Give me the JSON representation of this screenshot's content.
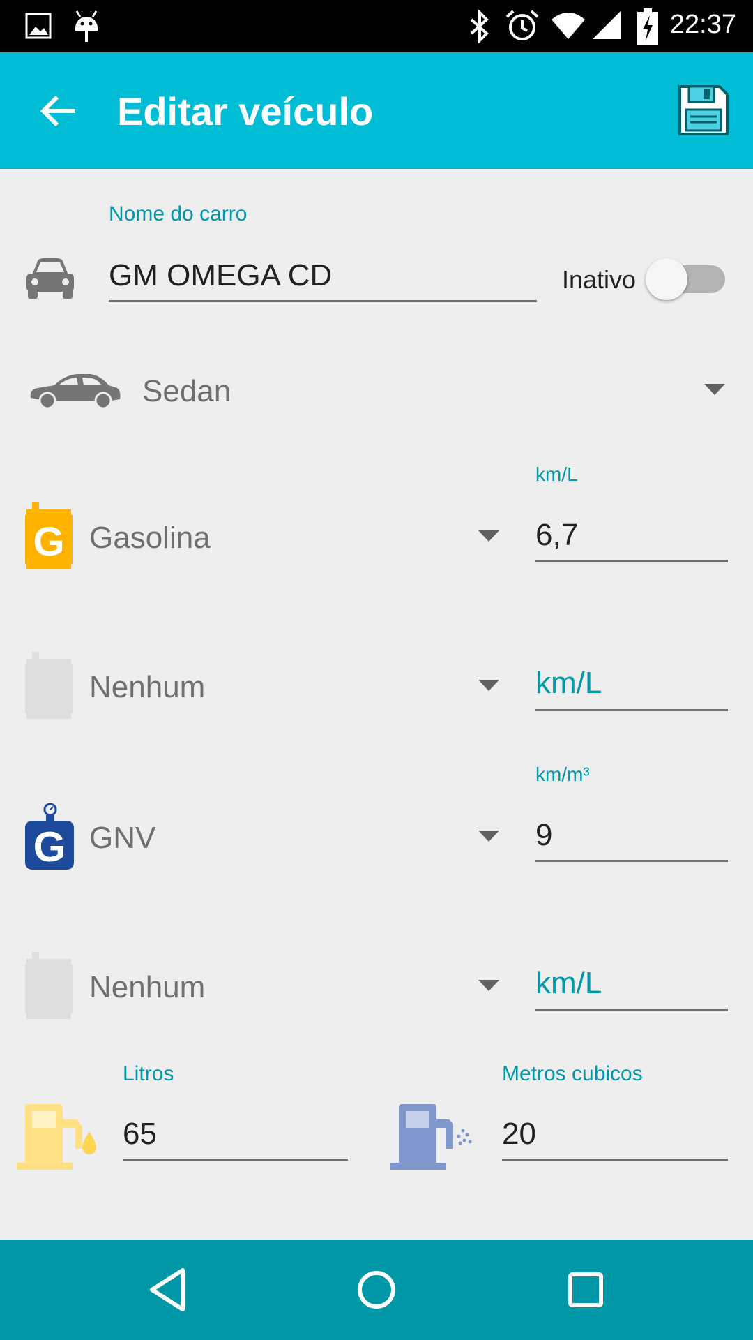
{
  "status_bar": {
    "time": "22:37",
    "icons": [
      "image-icon",
      "android-icon",
      "bluetooth-icon",
      "alarm-icon",
      "wifi-icon",
      "signal-icon",
      "battery-charging-icon"
    ]
  },
  "app_bar": {
    "title": "Editar veículo",
    "back_icon": "arrow-back-icon",
    "save_icon": "floppy-save-icon"
  },
  "form": {
    "car_name": {
      "label": "Nome do carro",
      "value": "GM OMEGA CD",
      "icon": "car-front-icon"
    },
    "active_toggle": {
      "label": "Inativo",
      "checked": false
    },
    "body_type": {
      "value": "Sedan",
      "icon": "sedan-icon"
    },
    "fuels": [
      {
        "name": "Gasolina",
        "icon": "gasoline-can-icon",
        "color": "#ffb300",
        "unit_label": "km/L",
        "value": "6,7"
      },
      {
        "name": "Nenhum",
        "icon": "empty-can-icon",
        "color": "#dddddd",
        "unit_label": "",
        "placeholder": "km/L"
      },
      {
        "name": "GNV",
        "icon": "gnv-cylinder-icon",
        "color": "#1e4a9c",
        "unit_label": "km/m³",
        "value": "9"
      },
      {
        "name": "Nenhum",
        "icon": "empty-can-icon",
        "color": "#dddddd",
        "unit_label": "",
        "placeholder": "km/L"
      }
    ],
    "tanks": [
      {
        "label": "Litros",
        "value": "65",
        "icon": "liquid-fuel-pump-icon",
        "color": "#ffe082"
      },
      {
        "label": "Metros cubicos",
        "value": "20",
        "icon": "gas-pump-icon",
        "color": "#7f97cc"
      }
    ]
  },
  "nav_bar": {
    "back": "nav-back-icon",
    "home": "nav-home-icon",
    "recents": "nav-recents-icon"
  },
  "colors": {
    "accent": "#0097a7",
    "app_bar": "#00bcd4",
    "background": "#eeeeee"
  }
}
